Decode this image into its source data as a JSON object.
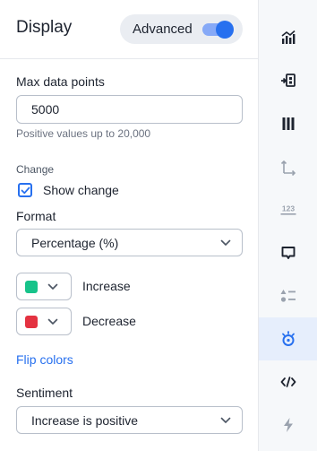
{
  "header": {
    "title": "Display",
    "advanced_label": "Advanced",
    "advanced_on": true
  },
  "max_points": {
    "label": "Max data points",
    "value": "5000",
    "hint": "Positive values up to 20,000"
  },
  "change": {
    "section_label": "Change",
    "show_change_label": "Show change",
    "show_change_checked": true
  },
  "format": {
    "label": "Format",
    "value": "Percentage (%)"
  },
  "colors": {
    "increase": {
      "label": "Increase",
      "color": "#17c38a"
    },
    "decrease": {
      "label": "Decrease",
      "color": "#e43241"
    }
  },
  "flip_colors_label": "Flip colors",
  "sentiment": {
    "label": "Sentiment",
    "value": "Increase is positive"
  },
  "sidebar": {
    "items": [
      {
        "name": "chart-icon"
      },
      {
        "name": "sort-icon"
      },
      {
        "name": "columns-icon"
      },
      {
        "name": "axes-icon"
      },
      {
        "name": "number-format-icon"
      },
      {
        "name": "tooltip-icon"
      },
      {
        "name": "legend-icon"
      },
      {
        "name": "display-settings-icon",
        "active": true
      },
      {
        "name": "embed-code-icon"
      },
      {
        "name": "lightning-icon"
      }
    ]
  },
  "accent_color": "#2770ef"
}
